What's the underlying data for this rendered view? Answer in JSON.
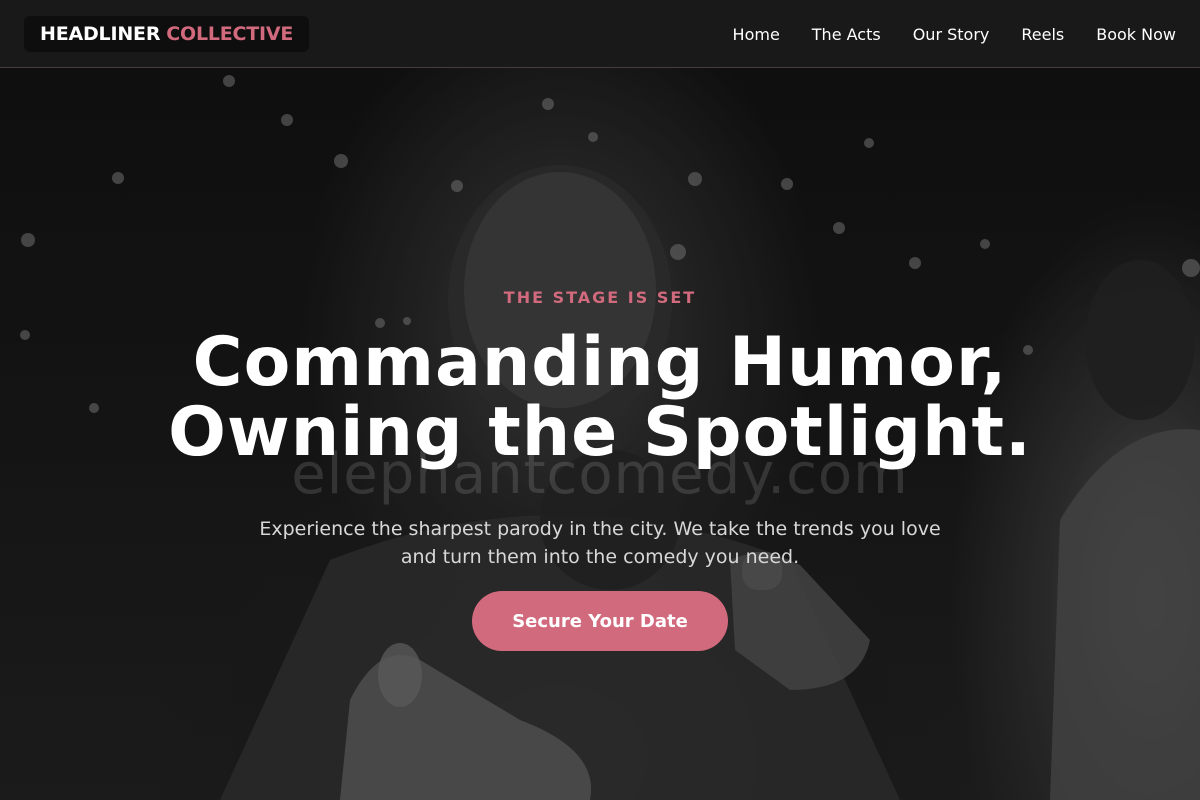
{
  "header": {
    "logo": {
      "word1": "HEADLINER",
      "word2": "COLLECTIVE"
    },
    "nav": [
      {
        "label": "Home"
      },
      {
        "label": "The Acts"
      },
      {
        "label": "Our Story"
      },
      {
        "label": "Reels"
      },
      {
        "label": "Book Now"
      }
    ]
  },
  "hero": {
    "eyebrow": "THE STAGE IS SET",
    "headline_line1": "Commanding Humor,",
    "headline_line2": "Owning the Spotlight.",
    "subtitle": "Experience the sharpest parody in the city. We take the trends you love and turn them into the comedy you need.",
    "cta_label": "Secure Your Date",
    "background_watermark": "elephantcomedy.com"
  },
  "colors": {
    "accent": "#d26a7e",
    "header_bg": "#1a1a1a",
    "text": "#ffffff"
  }
}
